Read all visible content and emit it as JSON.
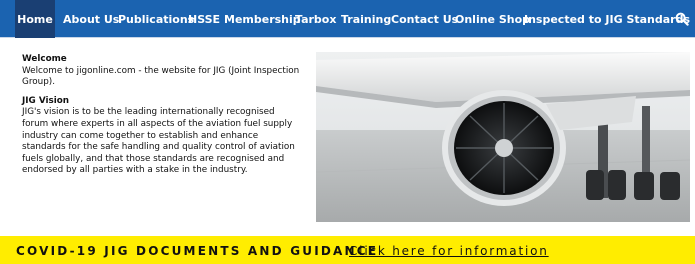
{
  "nav": {
    "items": [
      {
        "label": "Home",
        "active": true
      },
      {
        "label": "About Us"
      },
      {
        "label": "Publications"
      },
      {
        "label": "HSSE"
      },
      {
        "label": "Membership"
      },
      {
        "label": "Tarbox"
      },
      {
        "label": "Training"
      },
      {
        "label": "Contact Us"
      },
      {
        "label": "Online Shop"
      },
      {
        "label": "Inspected to JIG Standards"
      }
    ],
    "search_icon": "search-icon",
    "colors": {
      "bar": "#1b63b0",
      "active": "#1a3f73",
      "text": "#ffffff"
    }
  },
  "welcome": {
    "heading": "Welcome",
    "text": "Welcome to jigonline.com - the website for JIG (Joint Inspection Group)."
  },
  "vision": {
    "heading": "JIG Vision",
    "text": "JIG's vision is to be the leading internationally recognised forum where experts in all aspects of the aviation fuel supply industry can come together to establish and enhance standards for the safe handling and quality control of aviation fuels globally, and that those standards are recognised and endorsed by all parties with a stake in the industry."
  },
  "banner": {
    "title": "COVID-19 JIG DOCUMENTS AND GUIDANCE",
    "link": "Click here for information",
    "color": "#ffed00"
  }
}
